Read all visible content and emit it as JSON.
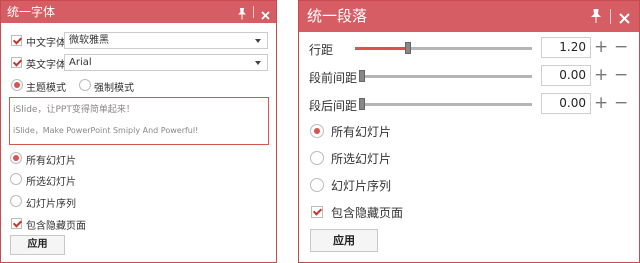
{
  "font_panel": {
    "title": "统一字体",
    "cn_font": {
      "label": "中文字体",
      "checked": true,
      "value": "微软雅黑"
    },
    "en_font": {
      "label": "英文字体",
      "checked": true,
      "value": "Arial"
    },
    "mode": {
      "options": [
        "主题模式",
        "强制模式"
      ],
      "selected": "主题模式"
    },
    "preview": {
      "line1": "iSlide，让PPT变得简单起来！",
      "line2": "iSlide，Make PowerPoint Smiply And Powerful!"
    },
    "scope": {
      "options": [
        "所有幻灯片",
        "所选幻灯片",
        "幻灯片序列"
      ],
      "selected": "所有幻灯片"
    },
    "include_hidden": {
      "label": "包含隐藏页面",
      "checked": true
    },
    "apply_label": "应用"
  },
  "para_panel": {
    "title": "统一段落",
    "rows": [
      {
        "label": "行距",
        "value": "1.20",
        "level": 0.3
      },
      {
        "label": "段前间距",
        "value": "0.00",
        "level": 0
      },
      {
        "label": "段后间距",
        "value": "0.00",
        "level": 0
      }
    ],
    "scope": {
      "options": [
        "所有幻灯片",
        "所选幻灯片",
        "幻灯片序列"
      ],
      "selected": "所有幻灯片"
    },
    "include_hidden": {
      "label": "包含隐藏页面",
      "checked": true
    },
    "apply_label": "应用",
    "plus_glyph": "+",
    "minus_glyph": "−"
  },
  "colors": {
    "accent": "#d65d63",
    "border": "#c94a4f",
    "check": "#c0392b"
  },
  "icons": {
    "pin": "pin-icon",
    "close": "close-icon"
  }
}
